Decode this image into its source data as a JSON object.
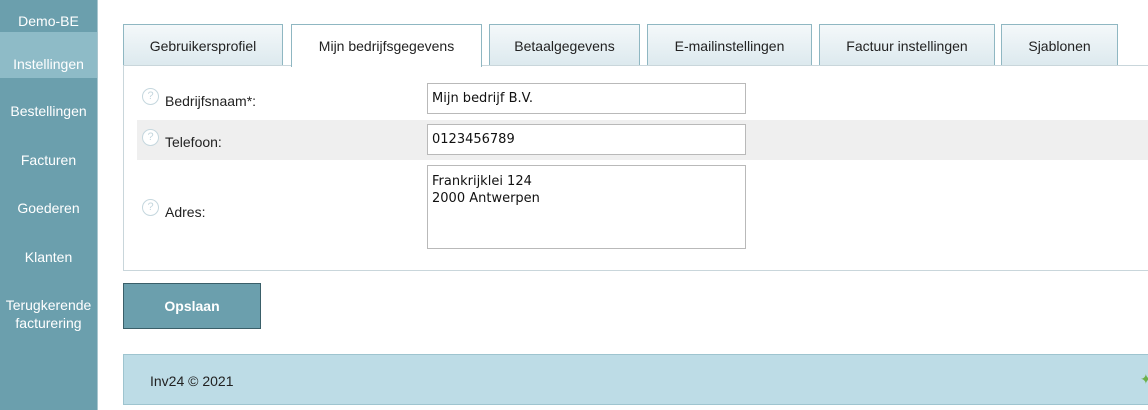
{
  "sidebar": {
    "brand": "Demo-BE",
    "items": [
      {
        "label": "Instellingen"
      },
      {
        "label": "Bestellingen"
      },
      {
        "label": "Facturen"
      },
      {
        "label": "Goederen"
      },
      {
        "label": "Klanten"
      },
      {
        "label": "Terugkerende facturering"
      }
    ]
  },
  "tabs": [
    {
      "label": "Gebruikersprofiel"
    },
    {
      "label": "Mijn bedrijfsgegevens"
    },
    {
      "label": "Betaalgegevens"
    },
    {
      "label": "E-mailinstellingen"
    },
    {
      "label": "Factuur instellingen"
    },
    {
      "label": "Sjablonen"
    }
  ],
  "form": {
    "company": {
      "label": "Bedrijfsnaam*:",
      "value": "Mijn bedrijf B.V."
    },
    "phone": {
      "label": "Telefoon:",
      "value": "0123456789"
    },
    "address": {
      "label": "Adres:",
      "value": "Frankrijklei 124\n2000 Antwerpen"
    },
    "help_glyph": "?"
  },
  "save_label": "Opslaan",
  "footer": {
    "text": "Inv24 © 2021",
    "icon_glyph": "✦"
  },
  "colors": {
    "sidebar": "#6b9fad",
    "sidebar_active": "#8ebbc7",
    "footer": "#bddce6",
    "tab_border": "#8fb7c2",
    "button": "#6b9fad"
  }
}
